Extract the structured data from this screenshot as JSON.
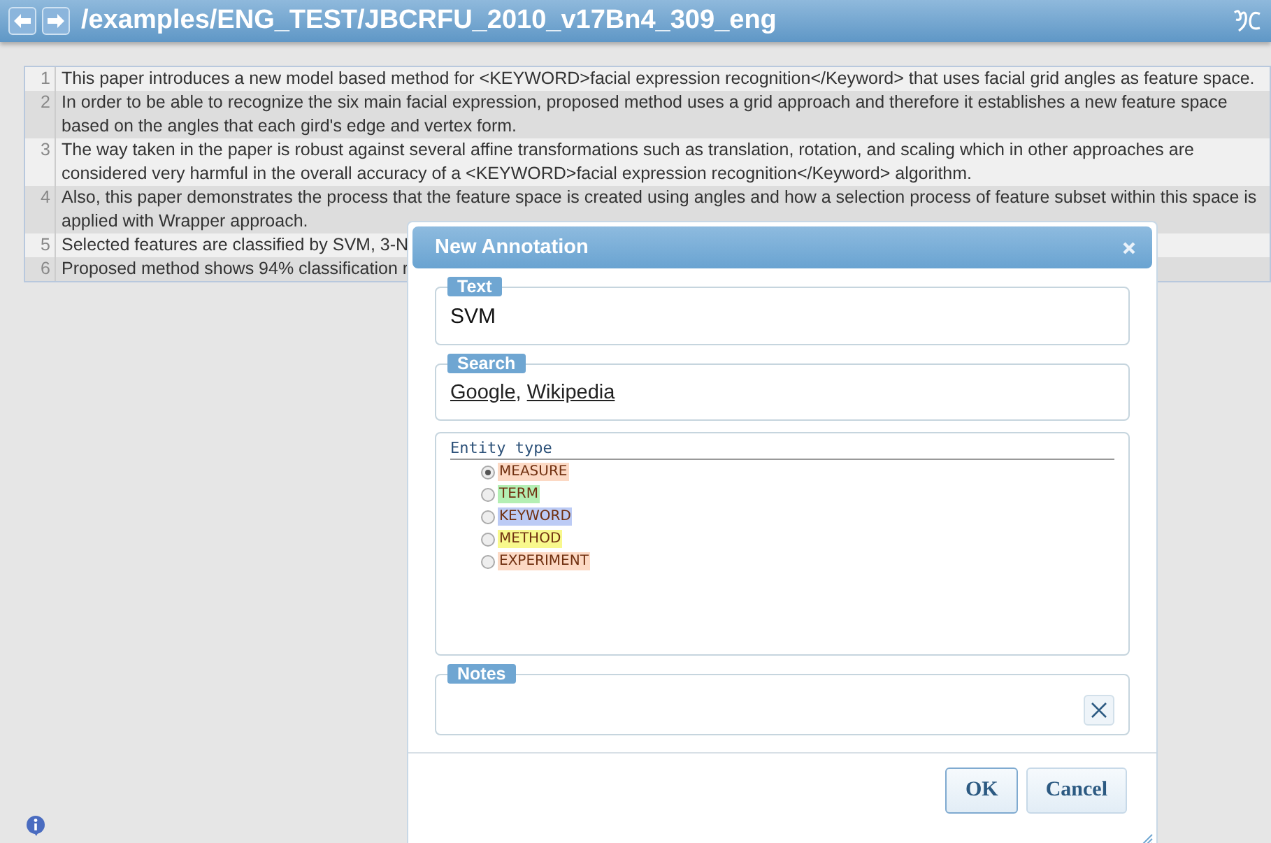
{
  "header": {
    "path": "/examples/ENG_TEST/JBCRFU_2010_v17Bn4_309_eng"
  },
  "document": {
    "lines": [
      {
        "number": "1",
        "text": "This paper introduces a new model based method for <KEYWORD>facial expression recognition</Keyword> that uses facial grid angles as feature space."
      },
      {
        "number": "2",
        "text": "In order to be able to recognize the six main facial expression, proposed method uses a grid approach and therefore it establishes a new feature space based on the angles that each gird's edge and vertex form."
      },
      {
        "number": "3",
        "text": "The way taken in the paper is robust against several affine transformations such as translation, rotation, and scaling which in other approaches are considered very harmful in the overall accuracy of a <KEYWORD>facial expression recognition</Keyword> algorithm."
      },
      {
        "number": "4",
        "text": "Also, this paper demonstrates the process that the feature space is created using angles and how a selection process of feature subset within this space is applied with Wrapper approach."
      },
      {
        "number": "5",
        "text": "Selected features are classified by SVM, 3-N"
      },
      {
        "number": "6",
        "text": "Proposed method shows 94% classification r"
      }
    ]
  },
  "dialog": {
    "title": "New Annotation",
    "text_field": {
      "legend": "Text",
      "value": "SVM"
    },
    "search": {
      "legend": "Search",
      "links": [
        "Google",
        "Wikipedia"
      ],
      "separator": ","
    },
    "entity_type": {
      "legend": "Entity type",
      "options": [
        {
          "label": "MEASURE",
          "selected": true,
          "color": "#fcd9c4"
        },
        {
          "label": "TERM",
          "selected": false,
          "color": "#b4efb4"
        },
        {
          "label": "KEYWORD",
          "selected": false,
          "color": "#bccbf5"
        },
        {
          "label": "METHOD",
          "selected": false,
          "color": "#f8f88c"
        },
        {
          "label": "EXPERIMENT",
          "selected": false,
          "color": "#fcd9c4"
        }
      ]
    },
    "notes": {
      "legend": "Notes"
    },
    "buttons": [
      "OK",
      "Cancel"
    ]
  }
}
